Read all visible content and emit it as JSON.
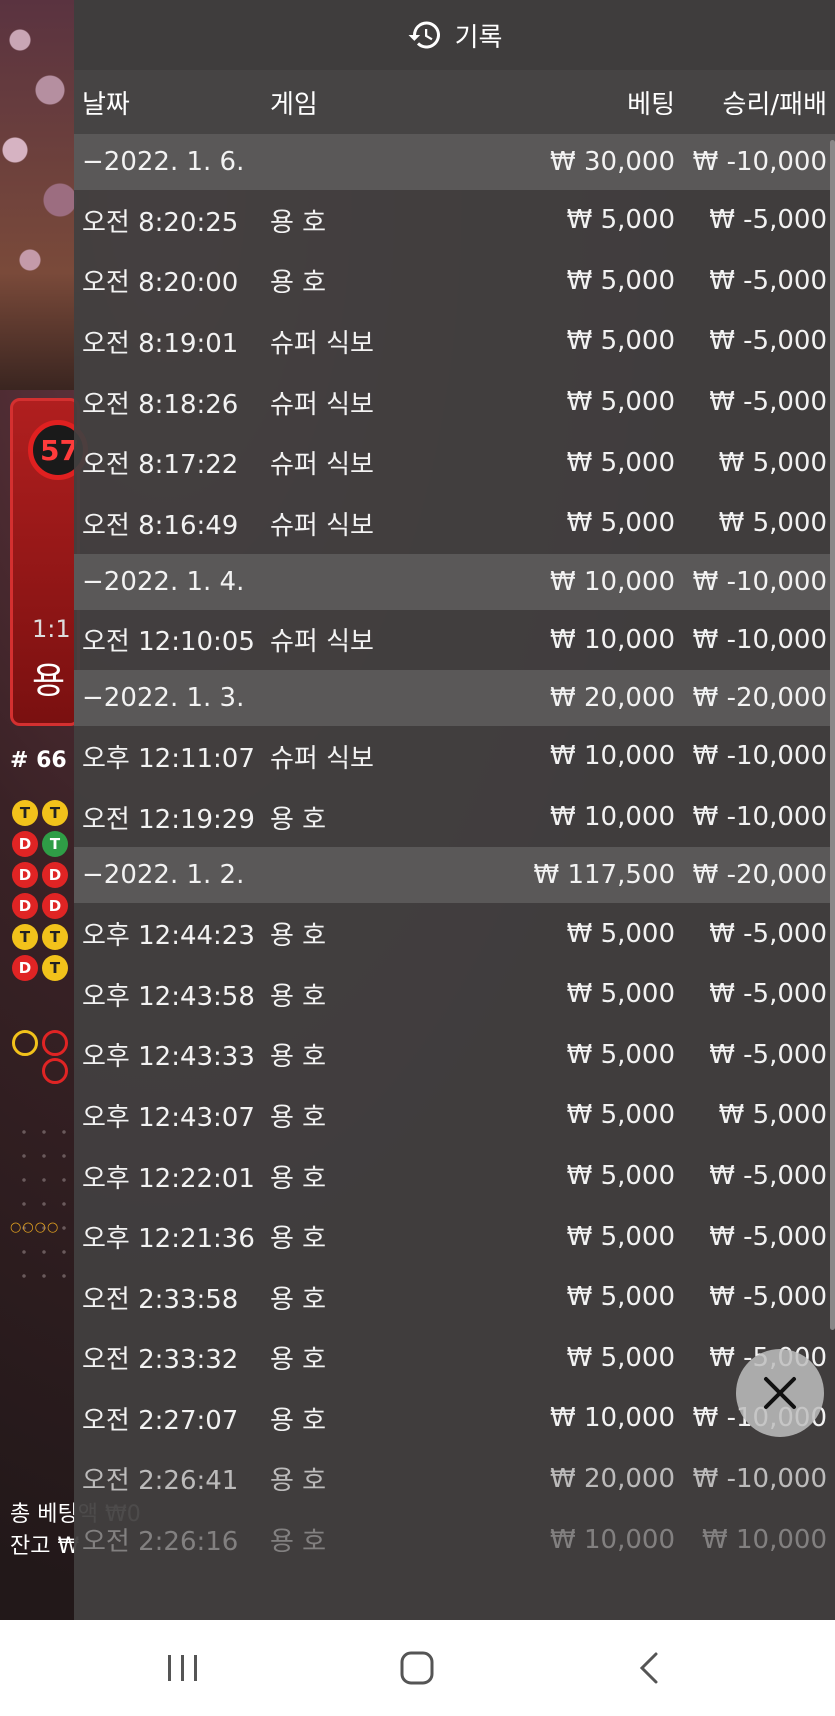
{
  "header": {
    "title": "기록"
  },
  "columns": {
    "date": "날짜",
    "game": "게임",
    "bet": "베팅",
    "result": "승리/패배"
  },
  "rows": [
    {
      "type": "date",
      "date": "−2022. 1. 6.",
      "game": "",
      "bet": "₩ 30,000",
      "result": "₩ -10,000"
    },
    {
      "type": "entry",
      "date": "오전 8:20:25",
      "game": "용 호",
      "bet": "₩ 5,000",
      "result": "₩ -5,000"
    },
    {
      "type": "entry",
      "date": "오전 8:20:00",
      "game": "용 호",
      "bet": "₩ 5,000",
      "result": "₩ -5,000"
    },
    {
      "type": "entry",
      "date": "오전 8:19:01",
      "game": "슈퍼 식보",
      "bet": "₩ 5,000",
      "result": "₩ -5,000"
    },
    {
      "type": "entry",
      "date": "오전 8:18:26",
      "game": "슈퍼 식보",
      "bet": "₩ 5,000",
      "result": "₩ -5,000"
    },
    {
      "type": "entry",
      "date": "오전 8:17:22",
      "game": "슈퍼 식보",
      "bet": "₩ 5,000",
      "result": "₩ 5,000"
    },
    {
      "type": "entry",
      "date": "오전 8:16:49",
      "game": "슈퍼 식보",
      "bet": "₩ 5,000",
      "result": "₩ 5,000"
    },
    {
      "type": "date",
      "date": "−2022. 1. 4.",
      "game": "",
      "bet": "₩ 10,000",
      "result": "₩ -10,000"
    },
    {
      "type": "entry",
      "date": "오전 12:10:05",
      "game": "슈퍼 식보",
      "bet": "₩ 10,000",
      "result": "₩ -10,000"
    },
    {
      "type": "date",
      "date": "−2022. 1. 3.",
      "game": "",
      "bet": "₩ 20,000",
      "result": "₩ -20,000"
    },
    {
      "type": "entry",
      "date": "오후 12:11:07",
      "game": "슈퍼 식보",
      "bet": "₩ 10,000",
      "result": "₩ -10,000"
    },
    {
      "type": "entry",
      "date": "오전 12:19:29",
      "game": "용 호",
      "bet": "₩ 10,000",
      "result": "₩ -10,000"
    },
    {
      "type": "date",
      "date": "−2022. 1. 2.",
      "game": "",
      "bet": "₩ 117,500",
      "result": "₩ -20,000"
    },
    {
      "type": "entry",
      "date": "오후 12:44:23",
      "game": "용 호",
      "bet": "₩ 5,000",
      "result": "₩ -5,000"
    },
    {
      "type": "entry",
      "date": "오후 12:43:58",
      "game": "용 호",
      "bet": "₩ 5,000",
      "result": "₩ -5,000"
    },
    {
      "type": "entry",
      "date": "오후 12:43:33",
      "game": "용 호",
      "bet": "₩ 5,000",
      "result": "₩ -5,000"
    },
    {
      "type": "entry",
      "date": "오후 12:43:07",
      "game": "용 호",
      "bet": "₩ 5,000",
      "result": "₩ 5,000"
    },
    {
      "type": "entry",
      "date": "오후 12:22:01",
      "game": "용 호",
      "bet": "₩ 5,000",
      "result": "₩ -5,000"
    },
    {
      "type": "entry",
      "date": "오후 12:21:36",
      "game": "용 호",
      "bet": "₩ 5,000",
      "result": "₩ -5,000"
    },
    {
      "type": "entry",
      "date": "오전 2:33:58",
      "game": "용 호",
      "bet": "₩ 5,000",
      "result": "₩ -5,000"
    },
    {
      "type": "entry",
      "date": "오전 2:33:32",
      "game": "용 호",
      "bet": "₩ 5,000",
      "result": "₩ -5,000"
    },
    {
      "type": "entry",
      "date": "오전 2:27:07",
      "game": "용 호",
      "bet": "₩ 10,000",
      "result": "₩ -10,000"
    },
    {
      "type": "entry",
      "date": "오전 2:26:41",
      "game": "용 호",
      "bet": "₩ 20,000",
      "result": "₩ -10,000"
    },
    {
      "type": "entry",
      "date": "오전 2:26:16",
      "game": "용 호",
      "bet": "₩ 10,000",
      "result": "₩ 10,000"
    }
  ],
  "background": {
    "timer": "57",
    "ratio": "1:1",
    "dragon": "용",
    "round": "# 66",
    "total_bet_label": "총 베팅액 ₩0",
    "balance_label": "잔고 ₩",
    "beads": [
      [
        "T",
        "T"
      ],
      [
        "D",
        "T"
      ],
      [
        "D",
        "D"
      ],
      [
        "D",
        "D"
      ],
      [
        "T",
        "T"
      ],
      [
        "D",
        "T"
      ]
    ]
  },
  "navbar": {
    "recents_icon": "recents-icon",
    "home_icon": "home-icon",
    "back_icon": "back-icon"
  }
}
